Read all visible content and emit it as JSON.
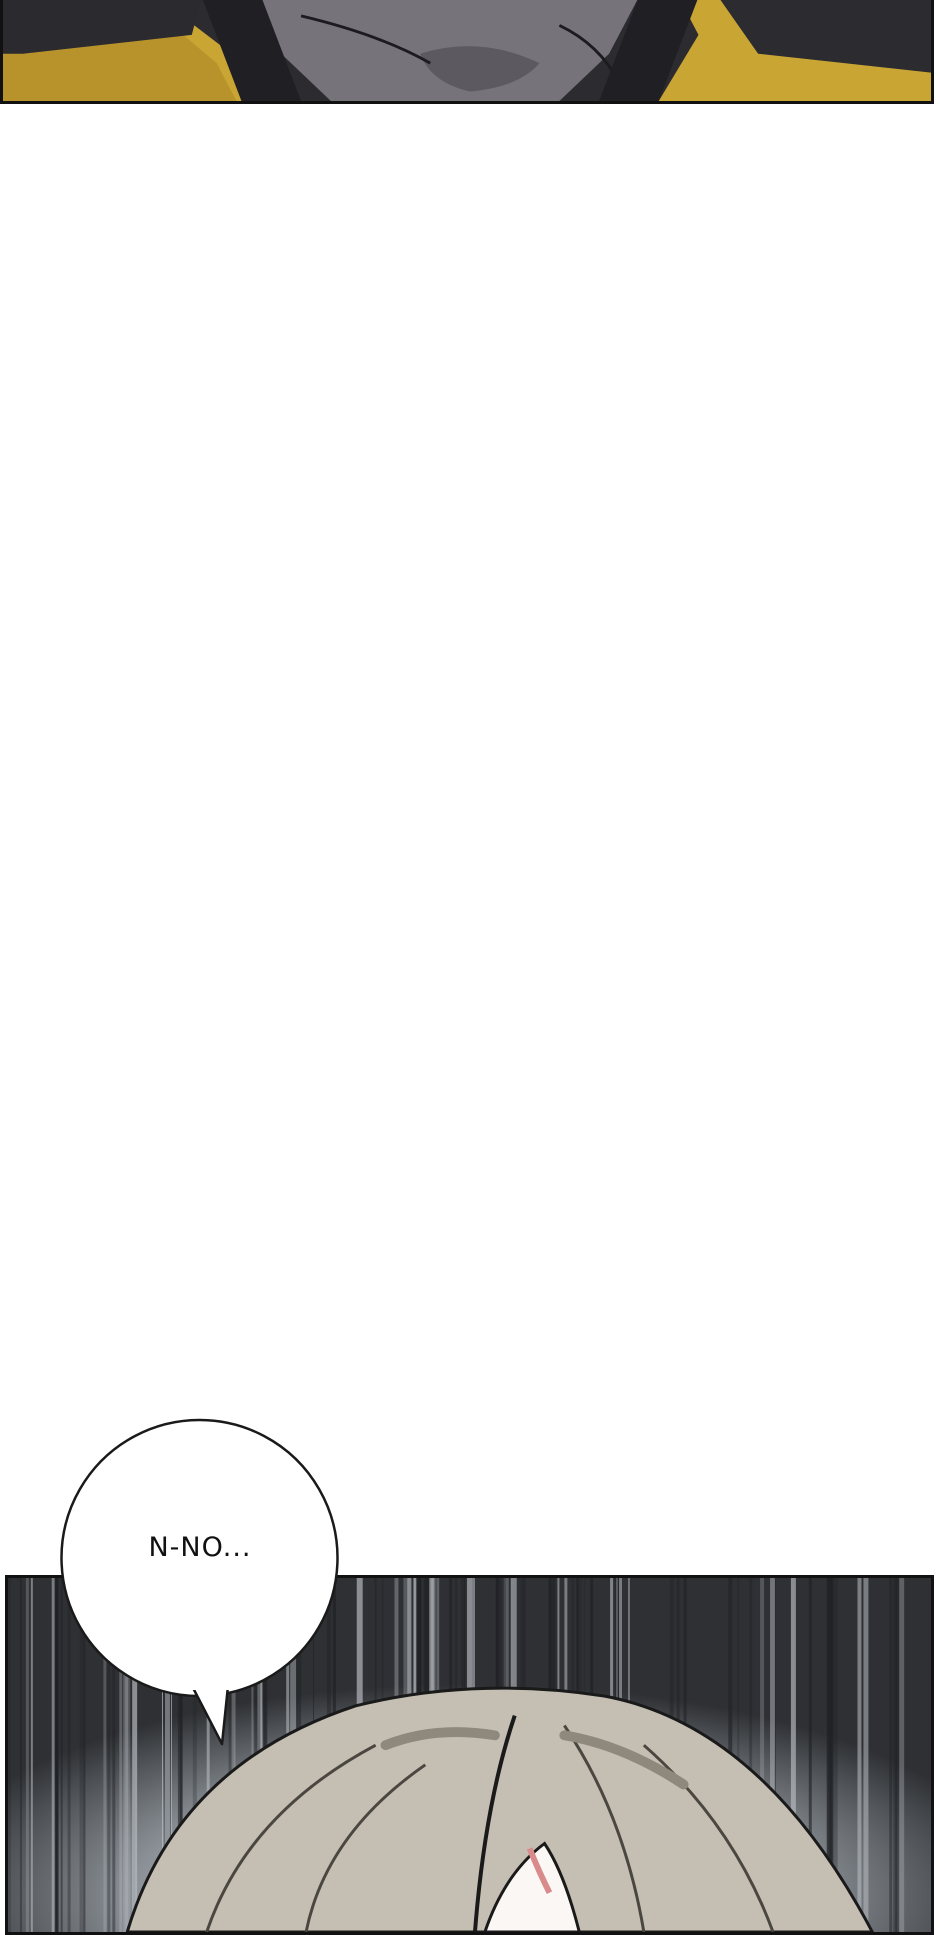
{
  "page": {
    "background": "#ffffff"
  },
  "panels": {
    "top": {
      "description_colors": {
        "cloak": "#2b2b30",
        "face": "#76747a",
        "collar": "#c9a534"
      }
    },
    "bottom": {
      "description_colors": {
        "background_dark": "#2e3033",
        "speed_lines": "#8a9096",
        "hair": "#c5bfb3"
      }
    }
  },
  "speech_bubble": {
    "text": "N-NO..."
  }
}
